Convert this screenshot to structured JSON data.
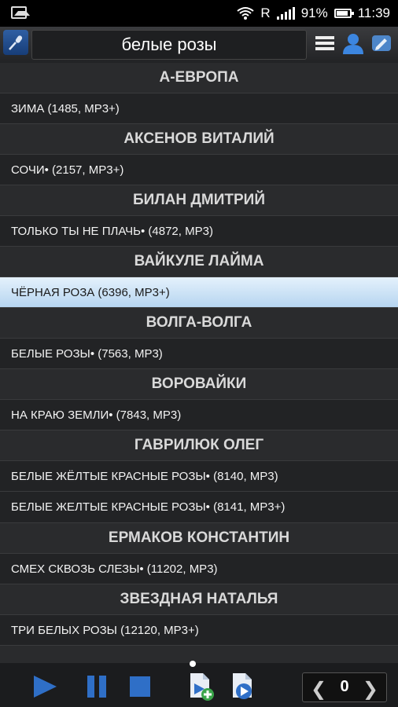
{
  "status": {
    "carrier": "R",
    "battery": "91%",
    "time": "11:39"
  },
  "toolbar": {
    "search_value": "белые розы"
  },
  "list": [
    {
      "type": "header",
      "text": "А-ЕВРОПА"
    },
    {
      "type": "row",
      "text": "ЗИМА (1485, MP3+)"
    },
    {
      "type": "header",
      "text": "АКСЕНОВ ВИТАЛИЙ"
    },
    {
      "type": "row",
      "text": "СОЧИ• (2157, MP3+)"
    },
    {
      "type": "header",
      "text": "БИЛАН ДМИТРИЙ"
    },
    {
      "type": "row",
      "text": "ТОЛЬКО ТЫ НЕ ПЛАЧЬ• (4872, MP3)"
    },
    {
      "type": "header",
      "text": "ВАЙКУЛЕ ЛАЙМА"
    },
    {
      "type": "row",
      "text": "ЧЁРНАЯ РОЗА (6396, MP3+)",
      "selected": true
    },
    {
      "type": "header",
      "text": "ВОЛГА-ВОЛГА"
    },
    {
      "type": "row",
      "text": "БЕЛЫЕ РОЗЫ• (7563, MP3)"
    },
    {
      "type": "header",
      "text": "ВОРОВАЙКИ"
    },
    {
      "type": "row",
      "text": "НА КРАЮ ЗЕМЛИ• (7843, MP3)"
    },
    {
      "type": "header",
      "text": "ГАВРИЛЮК ОЛЕГ"
    },
    {
      "type": "row",
      "text": "БЕЛЫЕ ЖЁЛТЫЕ КРАСНЫЕ РОЗЫ• (8140, MP3)"
    },
    {
      "type": "row",
      "text": "БЕЛЫЕ ЖЕЛТЫЕ КРАСНЫЕ РОЗЫ• (8141, MP3+)"
    },
    {
      "type": "header",
      "text": "ЕРМАКОВ КОНСТАНТИН"
    },
    {
      "type": "row",
      "text": "СМЕХ СКВОЗЬ СЛЕЗЫ• (11202, MP3)"
    },
    {
      "type": "header",
      "text": "ЗВЕЗДНАЯ НАТАЛЬЯ"
    },
    {
      "type": "row",
      "text": "ТРИ БЕЛЫХ РОЗЫ (12120, MP3+)"
    }
  ],
  "player": {
    "page_number": "0"
  },
  "colors": {
    "accent_blue": "#2f6fc7",
    "selected_row": "#cfe4f6",
    "background": "#2a2b2d"
  }
}
